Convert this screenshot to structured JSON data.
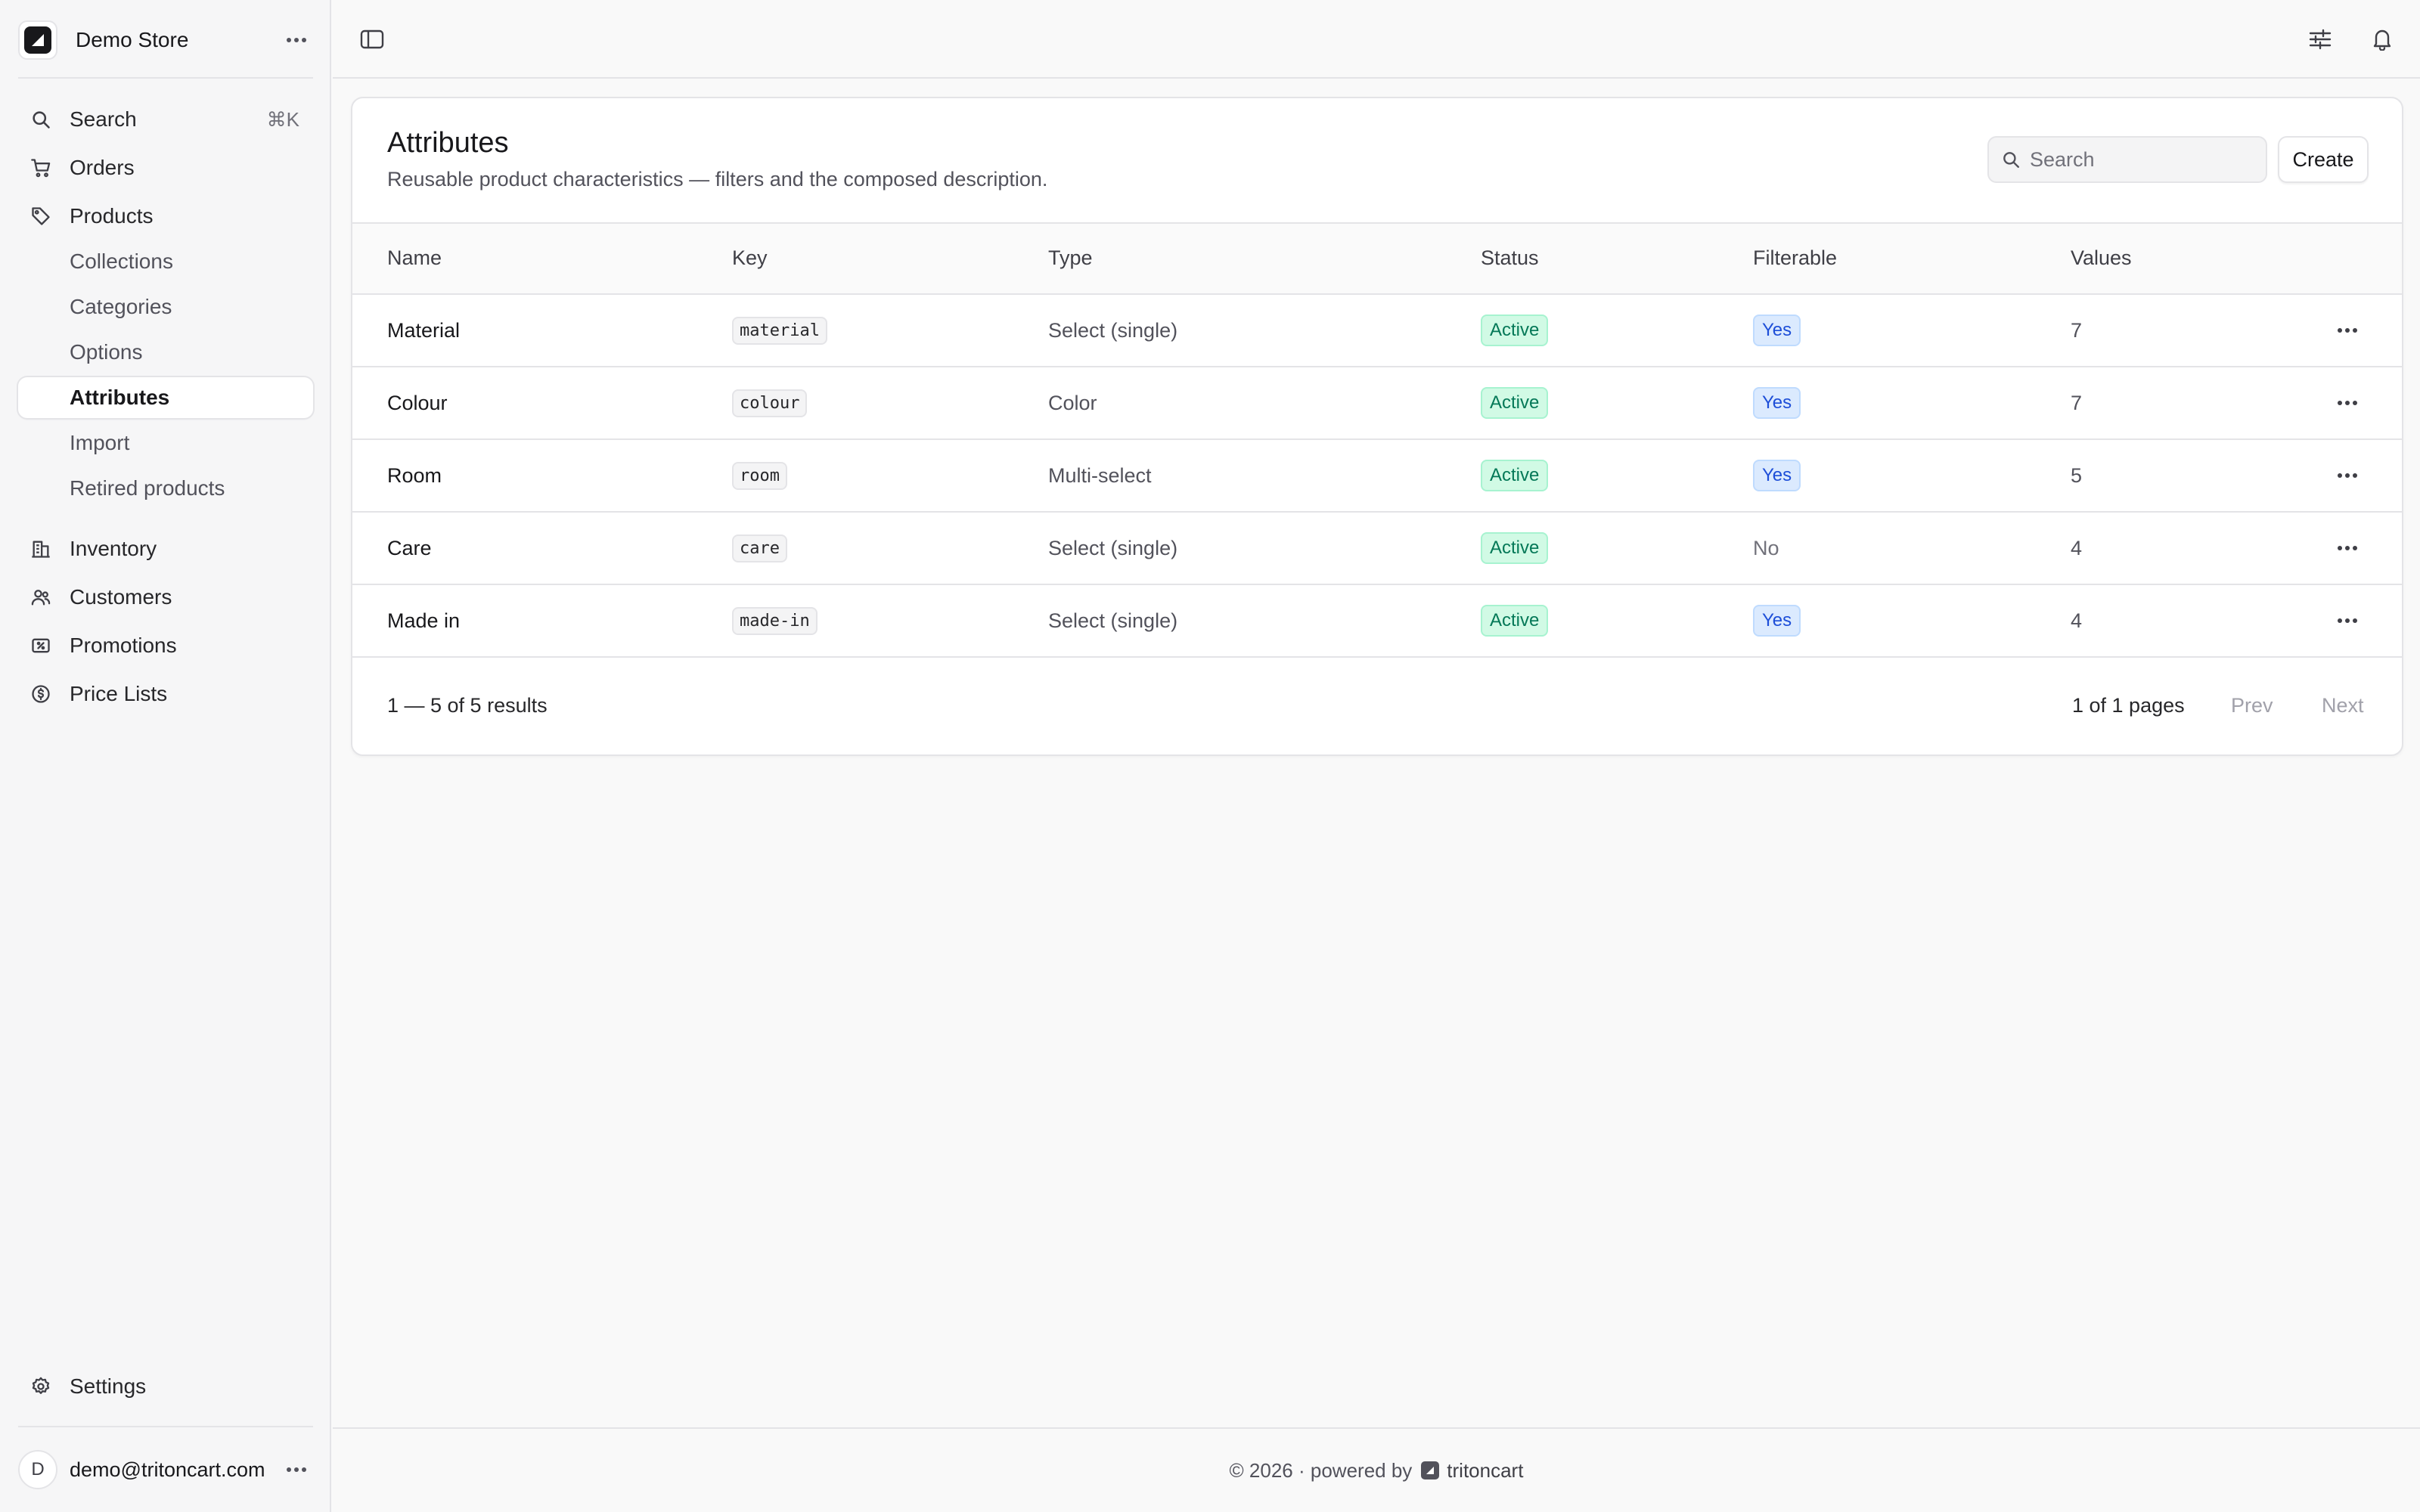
{
  "sidebar": {
    "store_name": "Demo Store",
    "search_label": "Search",
    "search_shortcut": "⌘K",
    "nav": {
      "orders": "Orders",
      "products": "Products",
      "inventory": "Inventory",
      "customers": "Customers",
      "promotions": "Promotions",
      "price_lists": "Price Lists",
      "settings": "Settings"
    },
    "product_subitems": [
      "Collections",
      "Categories",
      "Options",
      "Attributes",
      "Import",
      "Retired products"
    ],
    "active_subitem": "Attributes",
    "user": {
      "initial": "D",
      "email": "demo@tritoncart.com"
    }
  },
  "page": {
    "title": "Attributes",
    "subtitle": "Reusable product characteristics — filters and the composed description.",
    "search_placeholder": "Search",
    "create_label": "Create"
  },
  "table": {
    "columns": [
      "Name",
      "Key",
      "Type",
      "Status",
      "Filterable",
      "Values"
    ],
    "rows": [
      {
        "name": "Material",
        "key": "material",
        "type": "Select (single)",
        "status": "Active",
        "filterable": "Yes",
        "values": "7"
      },
      {
        "name": "Colour",
        "key": "colour",
        "type": "Color",
        "status": "Active",
        "filterable": "Yes",
        "values": "7"
      },
      {
        "name": "Room",
        "key": "room",
        "type": "Multi-select",
        "status": "Active",
        "filterable": "Yes",
        "values": "5"
      },
      {
        "name": "Care",
        "key": "care",
        "type": "Select (single)",
        "status": "Active",
        "filterable": "No",
        "values": "4"
      },
      {
        "name": "Made in",
        "key": "made-in",
        "type": "Select (single)",
        "status": "Active",
        "filterable": "Yes",
        "values": "4"
      }
    ]
  },
  "pagination": {
    "results": "1 — 5 of 5 results",
    "pages": "1 of 1 pages",
    "prev": "Prev",
    "next": "Next"
  },
  "footer": {
    "copyright": "© 2026 · powered by",
    "brand": "tritoncart"
  },
  "colors": {
    "active_badge_bg": "#d1fae5",
    "active_badge_text": "#047857",
    "yes_badge_bg": "#dbeafe",
    "yes_badge_text": "#1d4ed8"
  }
}
